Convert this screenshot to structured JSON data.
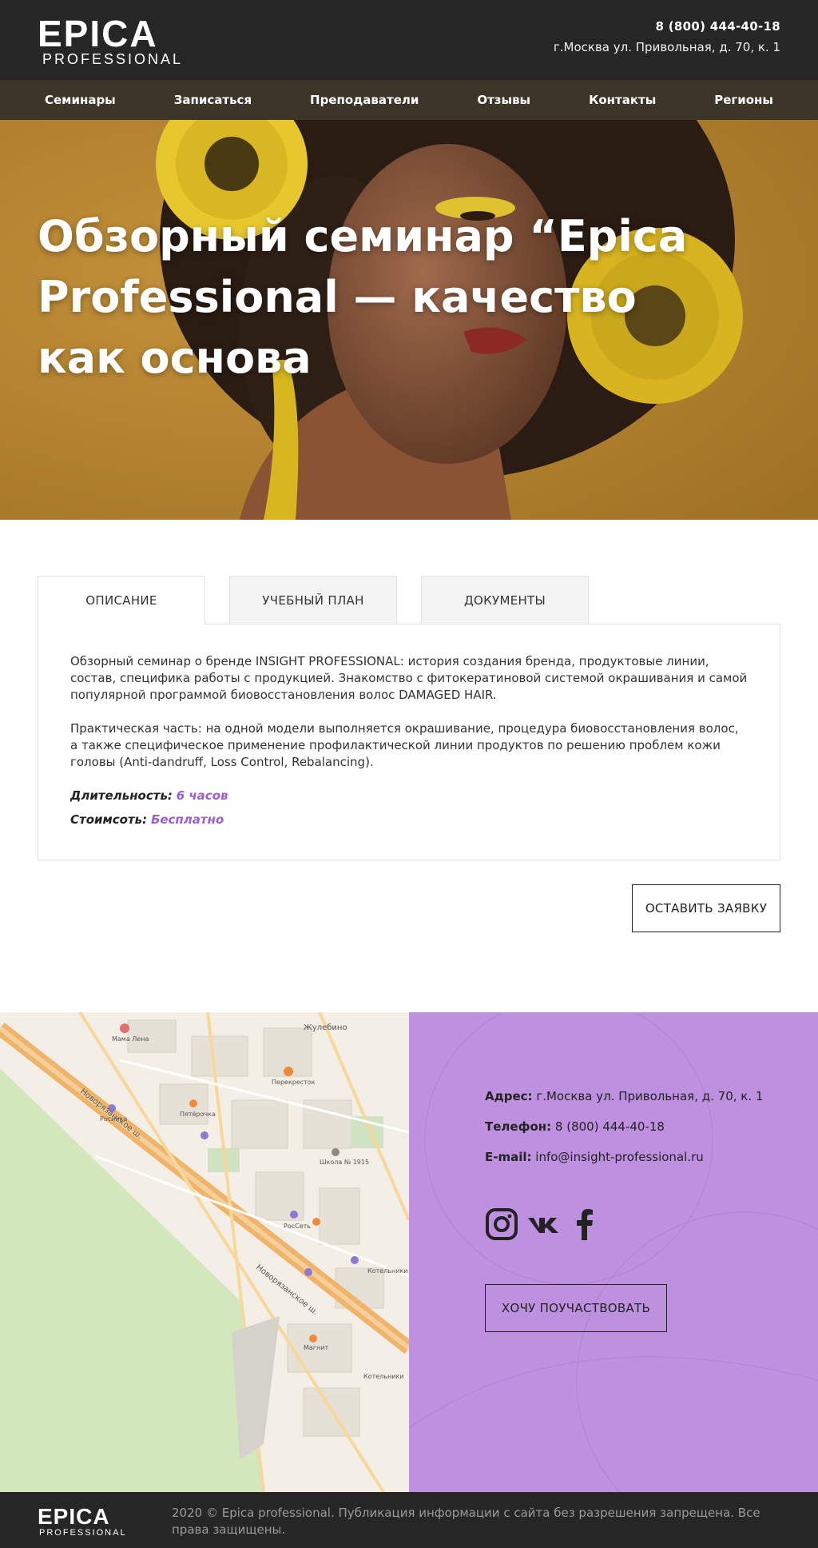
{
  "brand": {
    "name": "EPICA",
    "sub": "PROFESSIONAL"
  },
  "header": {
    "phone": "8 (800) 444-40-18",
    "address": "г.Москва ул. Привольная, д. 70, к. 1"
  },
  "nav": {
    "items": [
      "Семинары",
      "Записаться",
      "Преподаватели",
      "Отзывы",
      "Контакты",
      "Регионы"
    ]
  },
  "hero": {
    "title": "Обзорный семинар “Epica Professional — качество как основа"
  },
  "tabs": [
    "ОПИСАНИЕ",
    "УЧЕБНЫЙ ПЛАН",
    "ДОКУМЕНТЫ"
  ],
  "description": {
    "p1": "Обзорный семинар о бренде INSIGHT PROFESSIONAL: история создания бренда, продуктовые линии, состав, специфика работы с продукцией. Знакомство с фитокератиновой системой окрашивания и самой популярной программой биовосстановления волос DAMAGED HAIR.",
    "p2": "Практическая часть: на одной модели выполняется окрашивание, процедура биовосстановления волос, а также специфическое применение профилактической линии продуктов по решению проблем кожи головы (Anti-dandruff, Loss Control, Rebalancing).",
    "duration_label": "Длительность:",
    "duration_value": "6 часов",
    "price_label": "Стоимсоть:",
    "price_value": "Бесплатно"
  },
  "apply_button": "ОСТАВИТЬ ЗАЯВКУ",
  "map_labels": [
    "Новорязанское ш.",
    "Новорязанское ш.",
    "Жулебино",
    "Перекресток",
    "Пятёрочка",
    "Школа № 1915",
    "РосСеть",
    "Котельники",
    "Магнит",
    "Котельники",
    "Мама Лена",
    "Росинка"
  ],
  "contacts": {
    "address_label": "Адрес:",
    "address": "г.Москва ул. Привольная, д. 70, к. 1",
    "phone_label": "Телефон:",
    "phone": "8 (800) 444-40-18",
    "email_label": "E-mail:",
    "email": "info@insight-professional.ru",
    "social_icons": [
      "instagram-icon",
      "vk-icon",
      "facebook-icon"
    ]
  },
  "participate_button": "ХОЧУ ПОУЧАСТВОВАТЬ",
  "footer": {
    "copyright": "2020 © Epica professional. Публикация информации с сайта без разрешения запрещена. Все права защищены."
  },
  "colors": {
    "dark": "#262626",
    "nav": "#3d3528",
    "hero": "#b4862f",
    "accent": "#9b5fd0",
    "panel_purple": "#be90e0"
  }
}
